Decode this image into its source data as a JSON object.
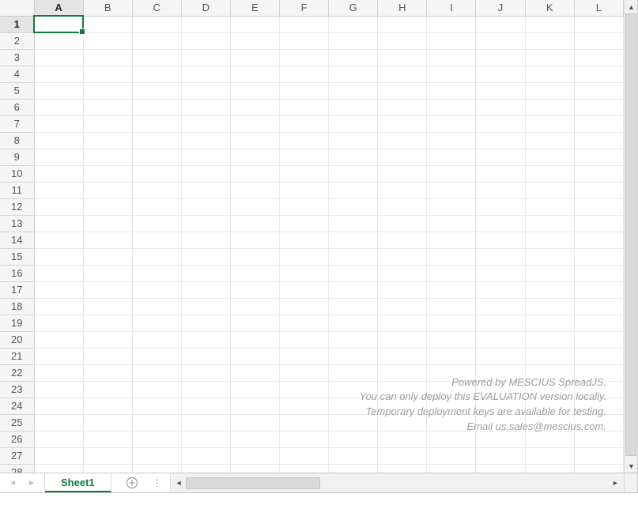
{
  "grid": {
    "columns": [
      "A",
      "B",
      "C",
      "D",
      "E",
      "F",
      "G",
      "H",
      "I",
      "J",
      "K",
      "L"
    ],
    "rows": [
      1,
      2,
      3,
      4,
      5,
      6,
      7,
      8,
      9,
      10,
      11,
      12,
      13,
      14,
      15,
      16,
      17,
      18,
      19,
      20,
      21,
      22,
      23,
      24,
      25,
      26,
      27,
      28
    ],
    "selected_cell": "A1",
    "active_column": "A",
    "active_row": 1
  },
  "watermark": {
    "line1": "Powered by MESCIUS SpreadJS.",
    "line2": "You can only deploy this EVALUATION version locally.",
    "line3": "Temporary deployment keys are available for testing.",
    "line4": "Email us.sales@mescius.com."
  },
  "tabs": {
    "active": "Sheet1"
  }
}
